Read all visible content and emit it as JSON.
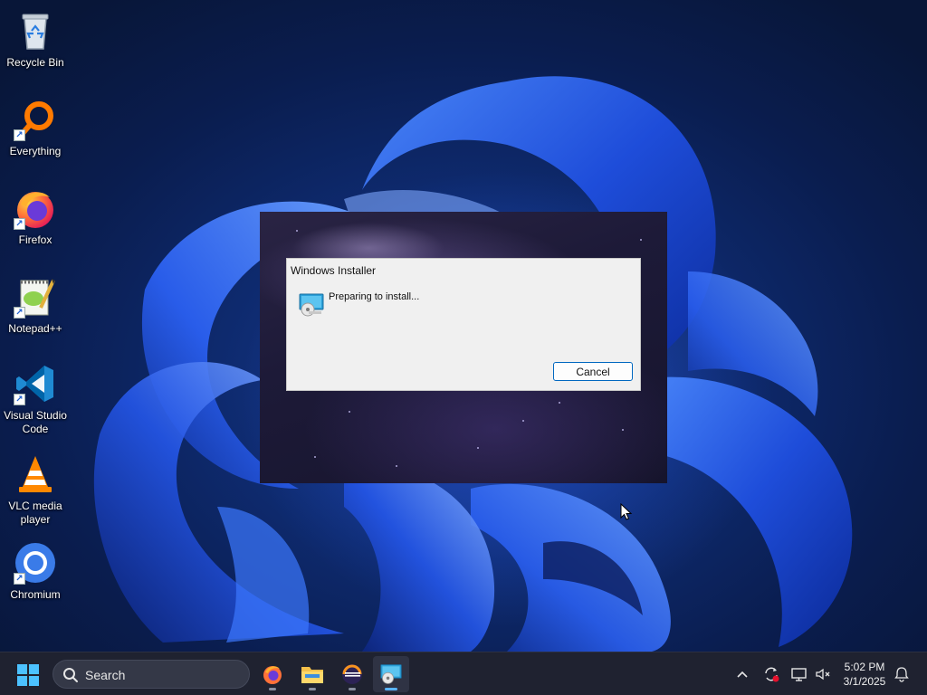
{
  "desktop": {
    "icons": [
      {
        "label": "Recycle Bin",
        "icon": "recycle-bin-icon"
      },
      {
        "label": "Everything",
        "icon": "everything-search-icon"
      },
      {
        "label": "Firefox",
        "icon": "firefox-icon"
      },
      {
        "label": "Notepad++",
        "icon": "notepadpp-icon"
      },
      {
        "label": "Visual Studio Code",
        "icon": "vscode-icon"
      },
      {
        "label": "VLC media player",
        "icon": "vlc-icon"
      },
      {
        "label": "Chromium",
        "icon": "chromium-icon"
      }
    ]
  },
  "installer": {
    "title": "Windows Installer",
    "message": "Preparing to install...",
    "cancel_label": "Cancel",
    "icon": "installer-disc-icon"
  },
  "taskbar": {
    "search_label": "Search",
    "apps": [
      {
        "name": "Firefox",
        "icon": "firefox-icon",
        "active": false
      },
      {
        "name": "File Explorer",
        "icon": "folder-icon",
        "active": false
      },
      {
        "name": "Eclipse",
        "icon": "eclipse-icon",
        "active": false
      },
      {
        "name": "Windows Installer",
        "icon": "installer-icon",
        "active": true
      }
    ],
    "tray": {
      "icons": [
        "chevron-up-icon",
        "sync-icon",
        "network-icon",
        "volume-muted-icon",
        "notification-bell-icon"
      ],
      "time": "5:02 PM",
      "date": "3/1/2025"
    }
  },
  "colors": {
    "accent": "#0067c0",
    "taskbar": "#1f2230",
    "active_indicator": "#5ab4ff"
  }
}
